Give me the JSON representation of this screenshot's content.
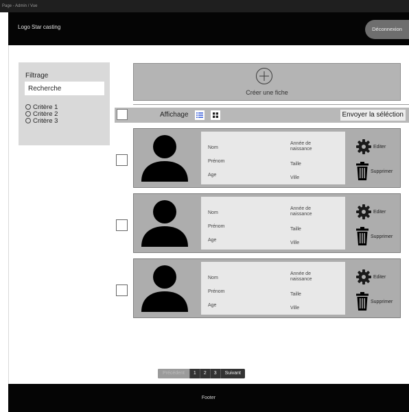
{
  "frame": {
    "title": "Page - Admin / Vue"
  },
  "header": {
    "logo": "Logo Star casting",
    "logout_label": "Déconnexion"
  },
  "sidebar": {
    "filter_title": "Filtrage",
    "search_value": "Recherche",
    "criteria": [
      "Critère 1",
      "Critère 2",
      "Critère 3"
    ]
  },
  "create_card": {
    "label": "Créer une fiche"
  },
  "toolbar": {
    "display_label": "Affichage",
    "send_label": "Envoyer la séléction"
  },
  "card_labels": {
    "nom": "Nom",
    "prenom": "Prénom",
    "age": "Age",
    "annee": "Année de\nnaissance",
    "taille": "Taille",
    "ville": "Ville",
    "edit": "Editer",
    "delete": "Supprimer"
  },
  "pagination": {
    "prev": "Précédent",
    "pages": [
      "1",
      "2",
      "3"
    ],
    "next": "Suivant"
  },
  "footer": {
    "label": "Footer"
  },
  "colors": {
    "header_bg": "#050505",
    "card_bg": "#adadad",
    "info_bg": "#e8e8e8",
    "logout_bg": "#6e6e6e"
  }
}
